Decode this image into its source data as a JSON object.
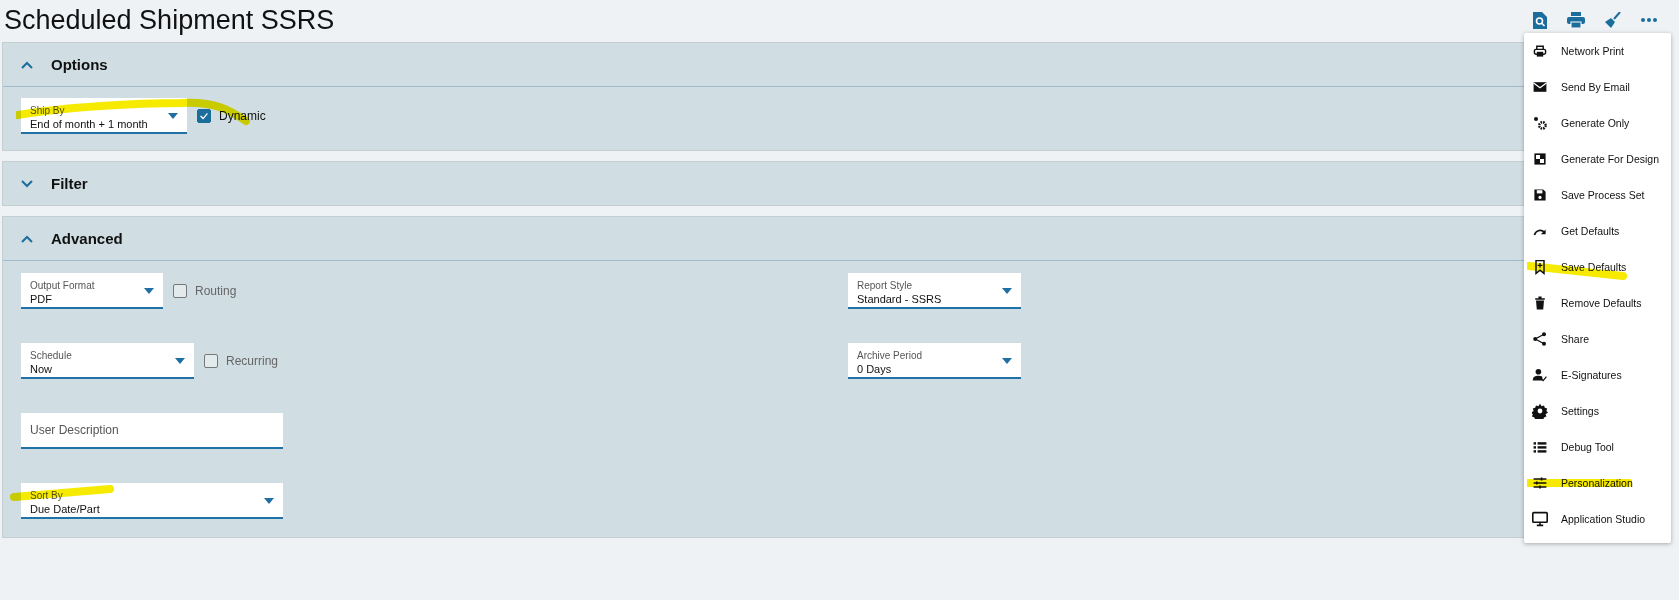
{
  "page": {
    "title": "Scheduled Shipment SSRS"
  },
  "sections": [
    {
      "title": "Options",
      "expanded": true,
      "rows": [
        {
          "left": [
            {
              "kind": "select",
              "label": "Ship By",
              "value": "End of month + 1 month"
            },
            {
              "kind": "checkbox",
              "label": "Dynamic",
              "checked": true
            }
          ],
          "right": []
        }
      ]
    },
    {
      "title": "Filter",
      "expanded": false
    },
    {
      "title": "Advanced",
      "expanded": true,
      "rows": [
        {
          "left": [
            {
              "kind": "select",
              "label": "Output Format",
              "value": "PDF"
            },
            {
              "kind": "checkbox",
              "label": "Routing",
              "checked": false
            }
          ],
          "right": [
            {
              "kind": "select",
              "label": "Report Style",
              "value": "Standard - SSRS"
            }
          ]
        },
        {
          "left": [
            {
              "kind": "select",
              "label": "Schedule",
              "value": "Now"
            },
            {
              "kind": "checkbox",
              "label": "Recurring",
              "checked": false
            }
          ],
          "right": [
            {
              "kind": "select",
              "label": "Archive Period",
              "value": "0 Days"
            }
          ]
        },
        {
          "left": [
            {
              "kind": "text",
              "placeholder": "User Description"
            }
          ],
          "right": []
        },
        {
          "left": [
            {
              "kind": "select",
              "label": "Sort By",
              "value": "Due Date/Part"
            }
          ],
          "right": []
        }
      ]
    }
  ],
  "menu": {
    "items": [
      {
        "label": "Network Print"
      },
      {
        "label": "Send By Email"
      },
      {
        "label": "Generate Only"
      },
      {
        "label": "Generate For Design"
      },
      {
        "label": "Save Process Set"
      },
      {
        "label": "Get Defaults"
      },
      {
        "label": "Save Defaults"
      },
      {
        "label": "Remove Defaults"
      },
      {
        "label": "Share"
      },
      {
        "label": "E-Signatures"
      },
      {
        "label": "Settings"
      },
      {
        "label": "Debug Tool"
      },
      {
        "label": "Personalization"
      },
      {
        "label": "Application Studio"
      }
    ]
  }
}
